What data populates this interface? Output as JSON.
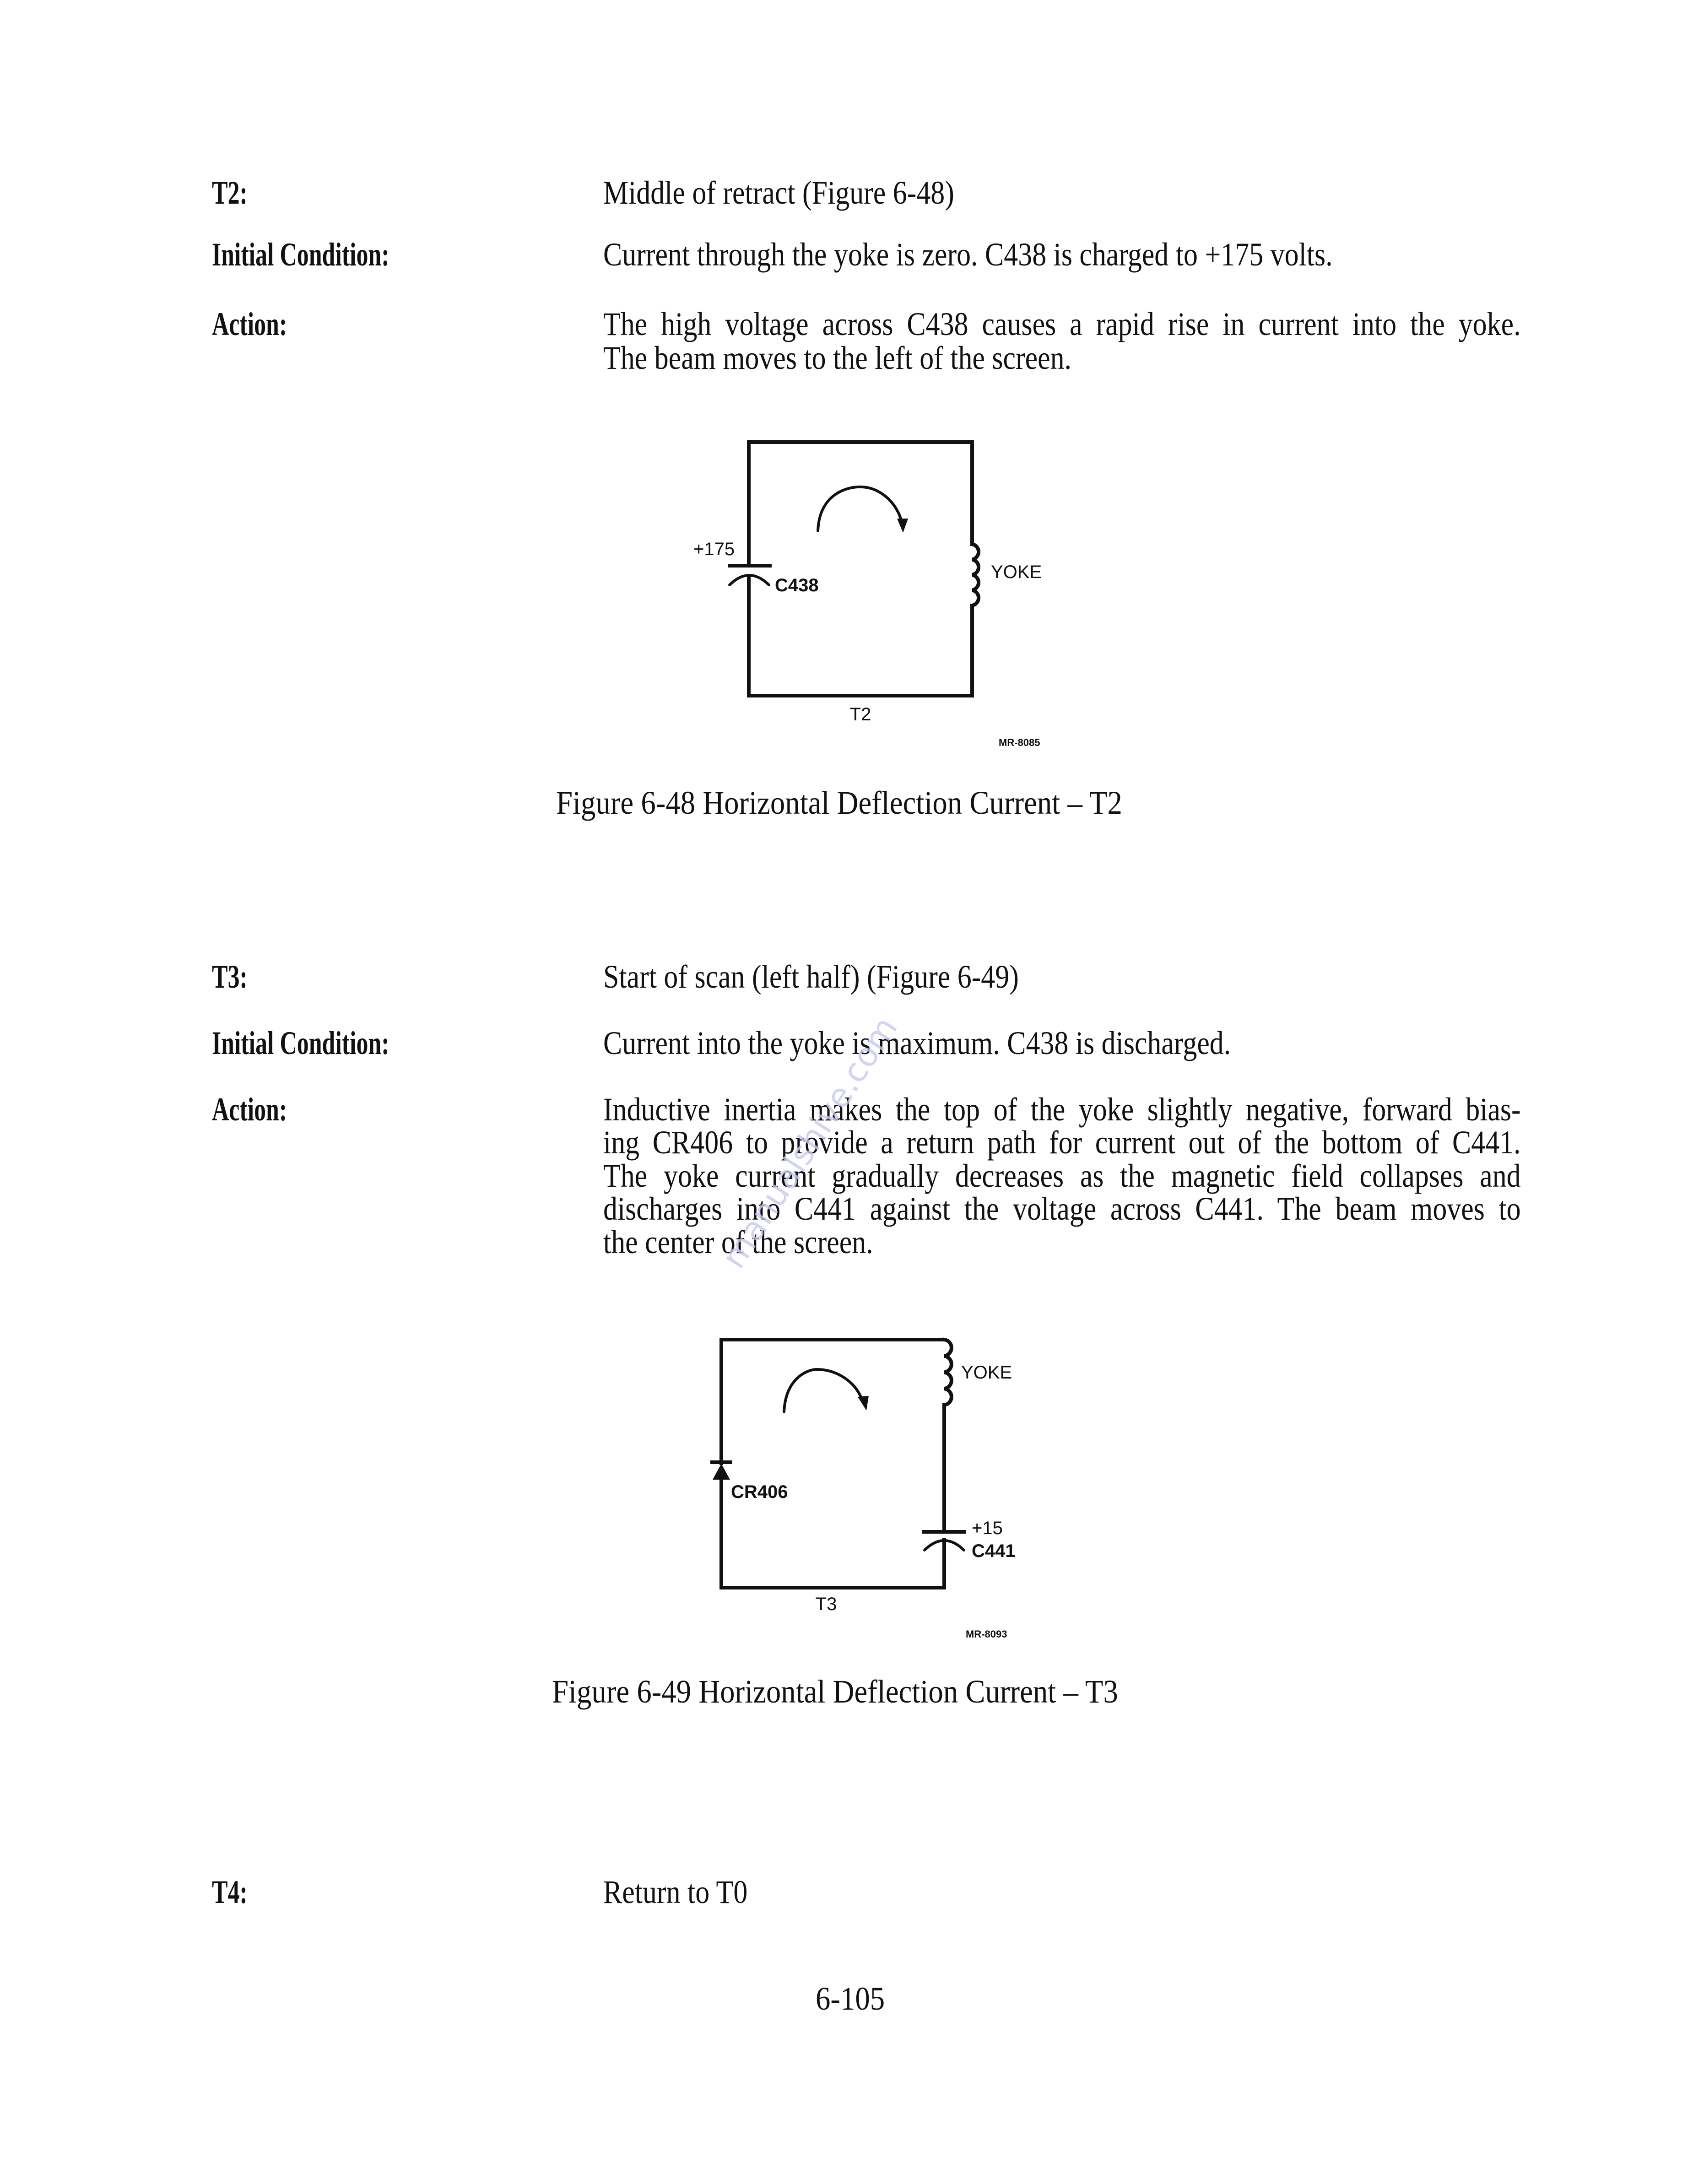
{
  "sections": {
    "t2": {
      "label": "T2:",
      "title": "Middle of retract (Figure 6-48)",
      "initial_label": "Initial Condition:",
      "initial_text": "Current through the yoke is zero. C438 is charged to +175 volts.",
      "action_label": "Action:",
      "action_lines": [
        "The high voltage across C438 causes a rapid rise in current into the yoke.",
        "The beam moves to the left of the screen."
      ]
    },
    "t3": {
      "label": "T3:",
      "title": "Start of scan (left half) (Figure 6-49)",
      "initial_label": "Initial Condition:",
      "initial_text": "Current into the yoke is maximum. C438 is discharged.",
      "action_label": "Action:",
      "action_lines": [
        "Inductive inertia makes the top of the yoke slightly negative, forward bias-",
        "ing CR406 to provide a return path for current out of the bottom of C441.",
        "The yoke current gradually decreases as the magnetic field collapses and",
        "discharges into C441 against the voltage across C441. The beam moves to",
        "the center of the screen."
      ]
    },
    "t4": {
      "label": "T4:",
      "title": "Return to T0"
    }
  },
  "figures": {
    "fig48": {
      "caption": "Figure 6-48   Horizontal Deflection Current – T2",
      "capacitor_voltage": "+175",
      "capacitor_name": "C438",
      "inductor_name": "YOKE",
      "state_label": "T2",
      "drawing_number": "MR-8085"
    },
    "fig49": {
      "caption": "Figure 6-49   Horizontal Deflection Current – T3",
      "diode_name": "CR406",
      "capacitor_voltage": "+15",
      "capacitor_name": "C441",
      "inductor_name": "YOKE",
      "state_label": "T3",
      "drawing_number": "MR-8093"
    }
  },
  "page_number": "6-105",
  "watermark": "manualshive.com"
}
